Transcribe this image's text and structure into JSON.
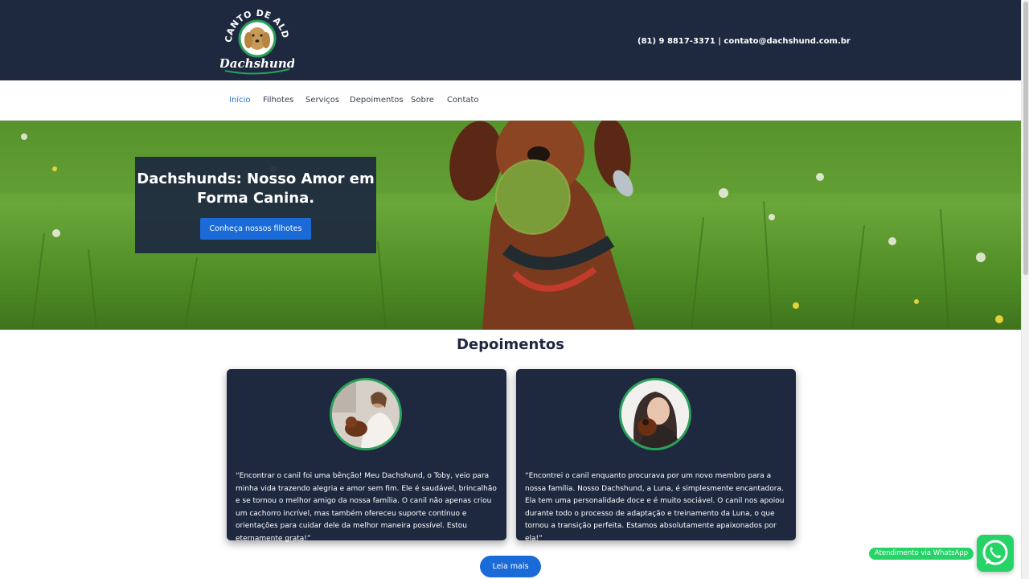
{
  "header": {
    "logo_top_text": "RECANTO DE ALDEIA",
    "logo_script_text": "Dachshund",
    "contact": "(81) 9 8817-3371 | contato@dachshund.com.br"
  },
  "nav": {
    "items": [
      {
        "label": "Início",
        "active": true
      },
      {
        "label": "Filhotes",
        "active": false
      },
      {
        "label": "Serviços",
        "active": false
      },
      {
        "label": "Depoimentos",
        "active": false
      },
      {
        "label": "Sobre",
        "active": false
      },
      {
        "label": "Contato",
        "active": false
      }
    ]
  },
  "hero": {
    "title": "Dachshunds: Nosso Amor em Forma Canina.",
    "button_label": "Conheça nossos filhotes"
  },
  "testimonials": {
    "title": "Depoimentos",
    "items": [
      {
        "quote": "“Encontrar o canil foi uma bênção! Meu Dachshund, o Toby, veio para minha vida trazendo alegria e amor sem fim. Ele é saudável, brincalhão e se tornou o melhor amigo da nossa família. O canil não apenas criou um cachorro incrível, mas também ofereceu suporte contínuo e orientações para cuidar dele da melhor maneira possível. Estou eternamente grata!”"
      },
      {
        "quote": "“Encontrei o canil enquanto procurava por um novo membro para a nossa família. Nosso Dachshund, a Luna, é simplesmente encantadora. Ela tem uma personalidade doce e é muito sociável. O canil nos apoiou durante todo o processo de adaptação e treinamento da Luna, o que tornou a transição perfeita. Estamos absolutamente apaixonados por ela!”"
      }
    ],
    "more_label": "Leia mais"
  },
  "whatsapp": {
    "label": "Atendimento via WhatsApp",
    "icon": "whatsapp-icon"
  },
  "colors": {
    "navy": "#1e2940",
    "accent_blue": "#1a6ad8",
    "nav_active": "#2f6fce",
    "whatsapp_green": "#25d366",
    "avatar_border": "#2aa05a"
  }
}
